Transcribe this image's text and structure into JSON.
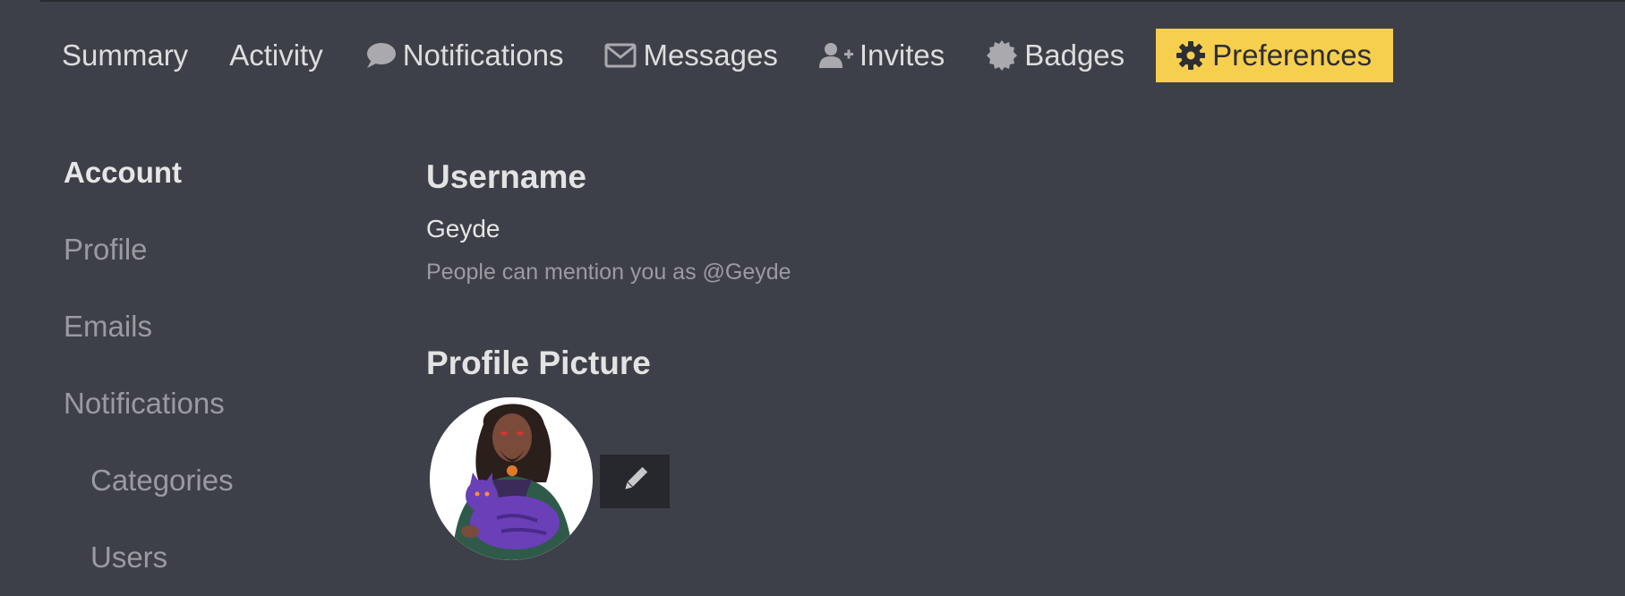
{
  "nav": {
    "tabs": [
      {
        "label": "Summary",
        "icon": ""
      },
      {
        "label": "Activity",
        "icon": ""
      },
      {
        "label": "Notifications",
        "icon": "comment-icon"
      },
      {
        "label": "Messages",
        "icon": "envelope-icon"
      },
      {
        "label": "Invites",
        "icon": "user-plus-icon"
      },
      {
        "label": "Badges",
        "icon": "certificate-icon"
      },
      {
        "label": "Preferences",
        "icon": "gear-icon",
        "active": true
      }
    ],
    "active_color": "#f7cf4f"
  },
  "sidebar": {
    "items": [
      {
        "label": "Account",
        "active": true
      },
      {
        "label": "Profile"
      },
      {
        "label": "Emails"
      },
      {
        "label": "Notifications"
      },
      {
        "label": "Categories",
        "sub": true
      },
      {
        "label": "Users",
        "sub": true
      }
    ]
  },
  "username": {
    "heading": "Username",
    "value": "Geyde",
    "helper": "People can mention you as @Geyde"
  },
  "profile_picture": {
    "heading": "Profile Picture",
    "edit_icon": "pencil-icon"
  }
}
